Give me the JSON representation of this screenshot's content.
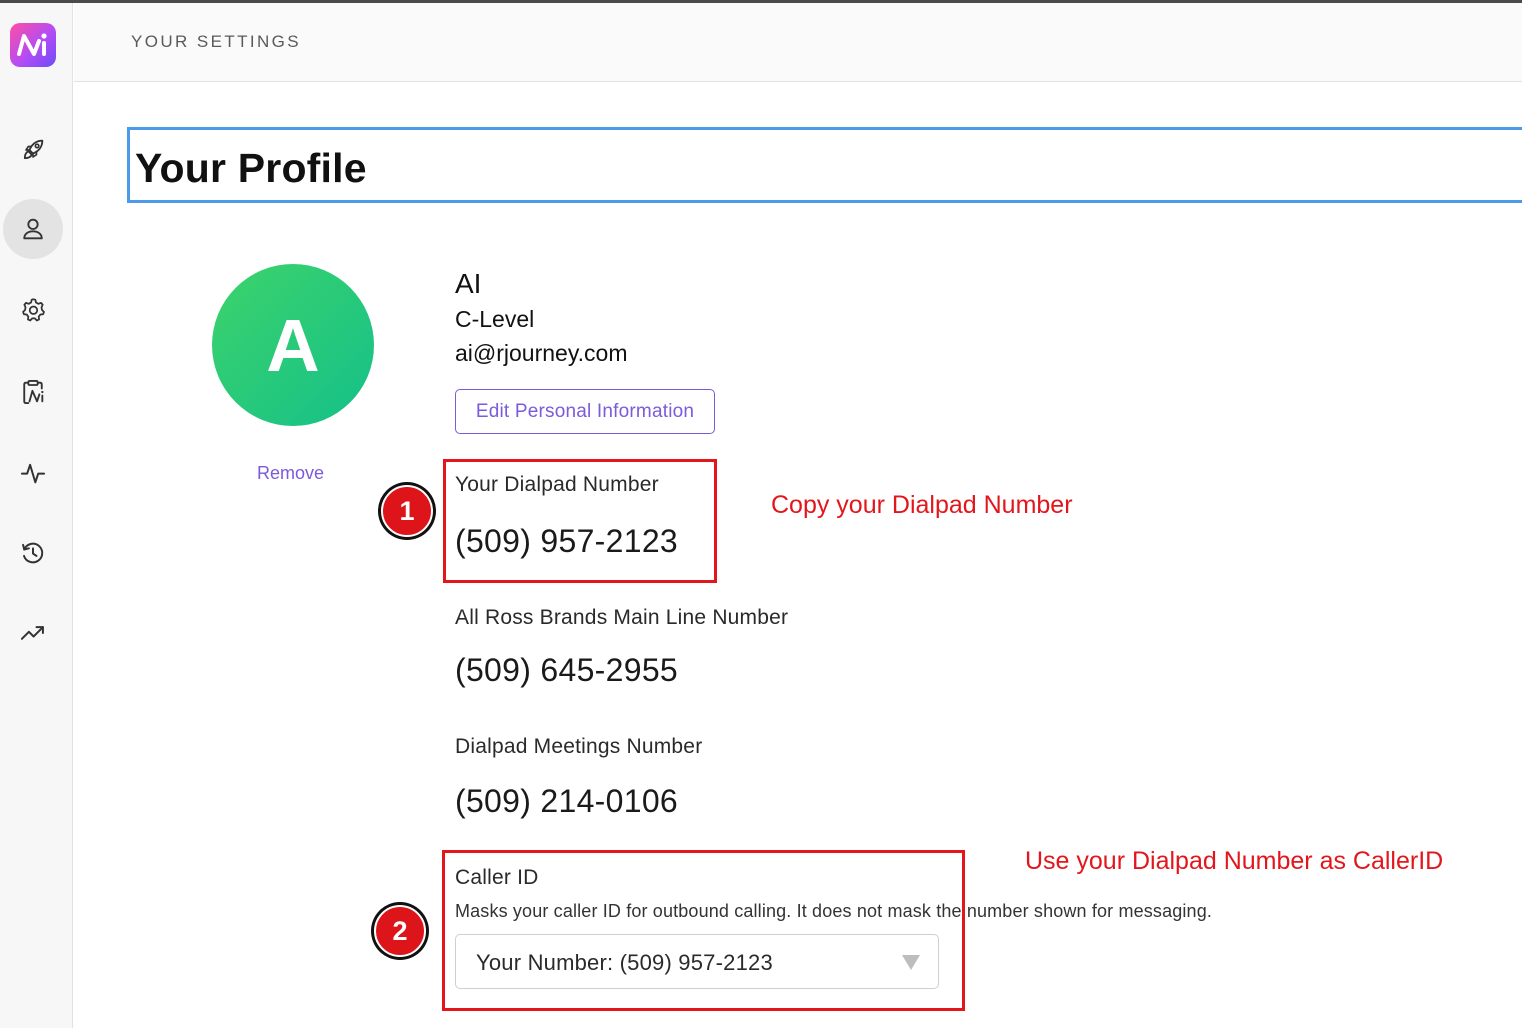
{
  "app": {
    "logo_text": "Ai"
  },
  "header": {
    "title": "YOUR SETTINGS"
  },
  "sidebar": {
    "items": [
      {
        "name": "rocket-icon",
        "active": false
      },
      {
        "name": "user-icon",
        "active": true
      },
      {
        "name": "gear-icon",
        "active": false
      },
      {
        "name": "clipboard-icon",
        "active": false
      },
      {
        "name": "activity-icon",
        "active": false
      },
      {
        "name": "history-icon",
        "active": false
      },
      {
        "name": "trending-icon",
        "active": false
      }
    ]
  },
  "page": {
    "title": "Your Profile"
  },
  "profile": {
    "avatar_letter": "A",
    "remove_label": "Remove",
    "name": "AI",
    "role": "C-Level",
    "email": "ai@rjourney.com",
    "edit_button": "Edit Personal Information"
  },
  "numbers": {
    "dialpad_label": "Your Dialpad Number",
    "dialpad_value": "(509) 957-2123",
    "main_line_label": "All Ross Brands Main Line Number",
    "main_line_value": "(509) 645-2955",
    "meetings_label": "Dialpad Meetings Number",
    "meetings_value": "(509) 214-0106"
  },
  "caller_id": {
    "label": "Caller ID",
    "help": "Masks your caller ID for outbound calling. It does not mask the number shown for messaging.",
    "selected": "Your Number: (509) 957-2123"
  },
  "annotations": {
    "step1": "1",
    "step1_text": "Copy your Dialpad Number",
    "step2": "2",
    "step2_text": "Use your Dialpad Number as CallerID"
  },
  "colors": {
    "accent": "#7b5bd9",
    "annotation_red": "#e3161c",
    "title_outline": "#4b9be8",
    "avatar": "#1fc97a"
  }
}
